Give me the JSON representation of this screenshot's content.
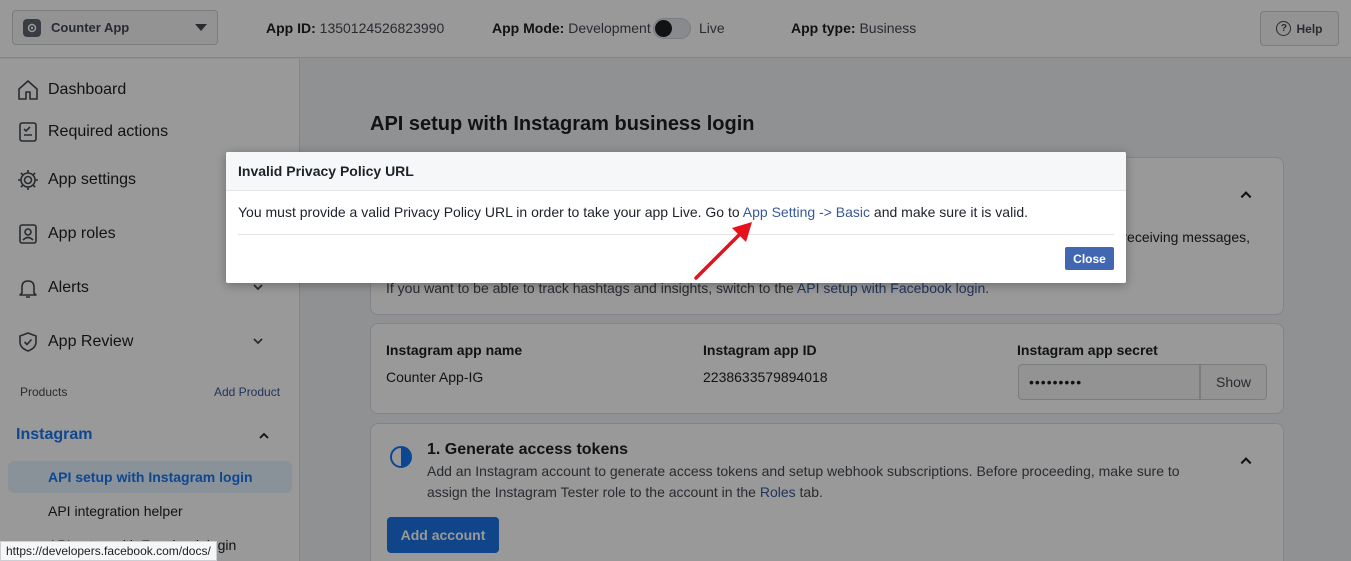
{
  "topbar": {
    "app_name": "Counter App",
    "app_id_label": "App ID:",
    "app_id": "1350124526823990",
    "app_mode_label": "App Mode:",
    "app_mode_value": "Development",
    "live_label": "Live",
    "app_type_label": "App type:",
    "app_type_value": "Business",
    "help_label": "Help"
  },
  "sidebar": {
    "items": [
      {
        "label": "Dashboard"
      },
      {
        "label": "Required actions"
      },
      {
        "label": "App settings"
      },
      {
        "label": "App roles"
      },
      {
        "label": "Alerts"
      },
      {
        "label": "App Review"
      }
    ],
    "products_label": "Products",
    "add_product_label": "Add Product",
    "instagram_label": "Instagram",
    "sub_items": [
      {
        "label": "API setup with Instagram login"
      },
      {
        "label": "API integration helper"
      },
      {
        "label": "API setup with Facebook login"
      }
    ]
  },
  "status_url": "https://developers.facebook.com/docs/",
  "main": {
    "title": "API setup with Instagram business login",
    "top_card": {
      "receiving_text": "receiving messages,",
      "track_text": "If you want to be able to track hashtags and insights, switch to the ",
      "track_link": "API setup with Facebook login",
      "track_end": "."
    },
    "info_card": {
      "name_label": "Instagram app name",
      "name_value": "Counter App-IG",
      "id_label": "Instagram app ID",
      "id_value": "2238633579894018",
      "secret_label": "Instagram app secret",
      "secret_value": "•••••••••",
      "show_label": "Show"
    },
    "gen_card": {
      "title": "1. Generate access tokens",
      "desc_start": "Add an Instagram account to generate access tokens and setup webhook subscriptions. Before proceeding, make sure to assign the Instagram Tester role to the account in the ",
      "desc_link": "Roles",
      "desc_end": " tab.",
      "add_account_label": "Add account"
    }
  },
  "dialog": {
    "title": "Invalid Privacy Policy URL",
    "body_start": "You must provide a valid Privacy Policy URL in order to take your app Live. Go to ",
    "body_link": "App Setting -> Basic",
    "body_end": " and make sure it is valid.",
    "close_label": "Close"
  },
  "colors": {
    "accent": "#1877f2",
    "link": "#385898",
    "close_button": "#4267b2",
    "arrow": "#e8101a"
  }
}
